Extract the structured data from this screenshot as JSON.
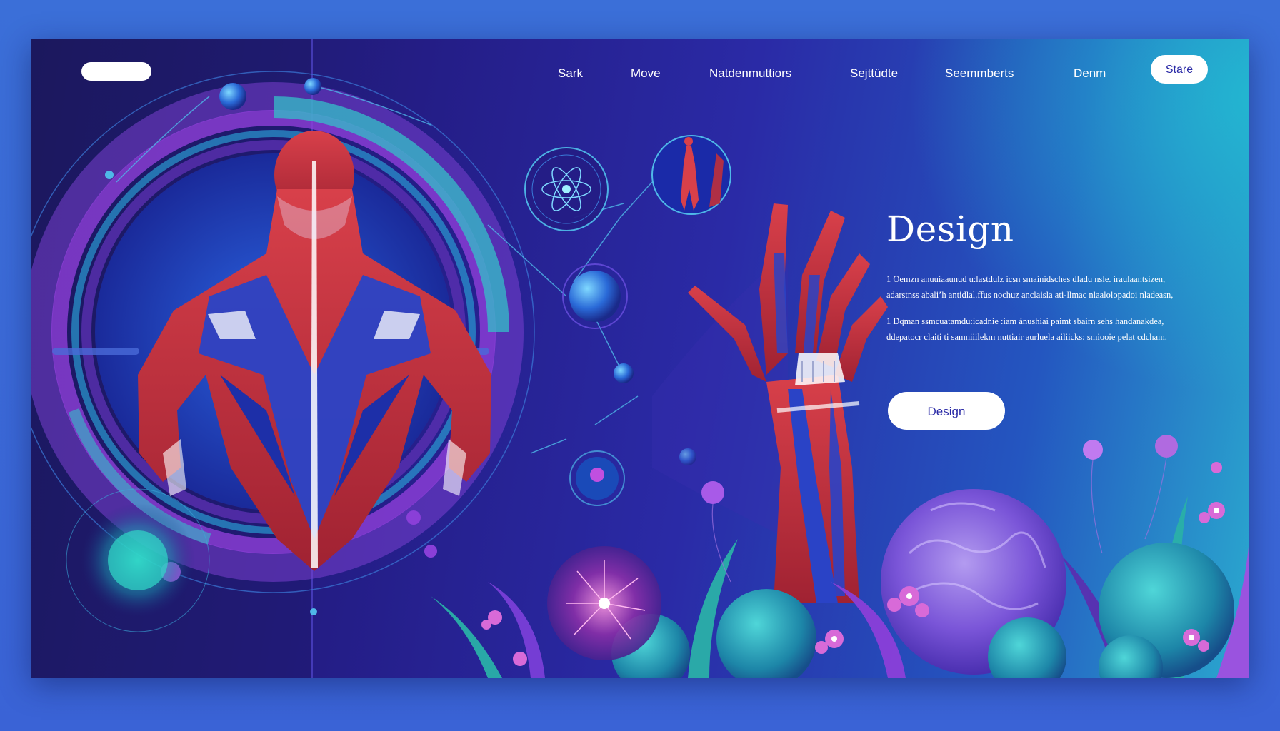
{
  "nav": {
    "items": [
      "Sark",
      "Move",
      "Natdenmuttiors",
      "Sejttüdte",
      "Seemmberts",
      "Denm"
    ],
    "share_label": "Stare"
  },
  "hero": {
    "title": "Design",
    "paragraph_1": [
      "1 Oemzn  anuuiaaunud u:lastdulz  icsn  smainidsches  dladu nsle. iraulaantsizen,",
      "adarstnss  abali’h antidlal.ffus  nochuz anclaisla ati-llmac nlaalolopadoi nladeasn,"
    ],
    "paragraph_2": [
      "1 Dqman  ssmcuatamdu:icadnie  :iam  ánushiai paimt  sbairn  sehs  handanakdea,",
      "ddepatocr  claiti ti samniiilekm  nuttiair  aurluela ailiicks: smiooie pelat cdcham."
    ],
    "cta_label": "Design"
  },
  "colors": {
    "frame_bg": "#241d86",
    "accent_teal": "#2aa9cf",
    "accent_purple": "#8a3fd8",
    "muscle_red": "#c0303a",
    "muscle_blue": "#2a43c6",
    "button_text": "#2a2aa6"
  }
}
